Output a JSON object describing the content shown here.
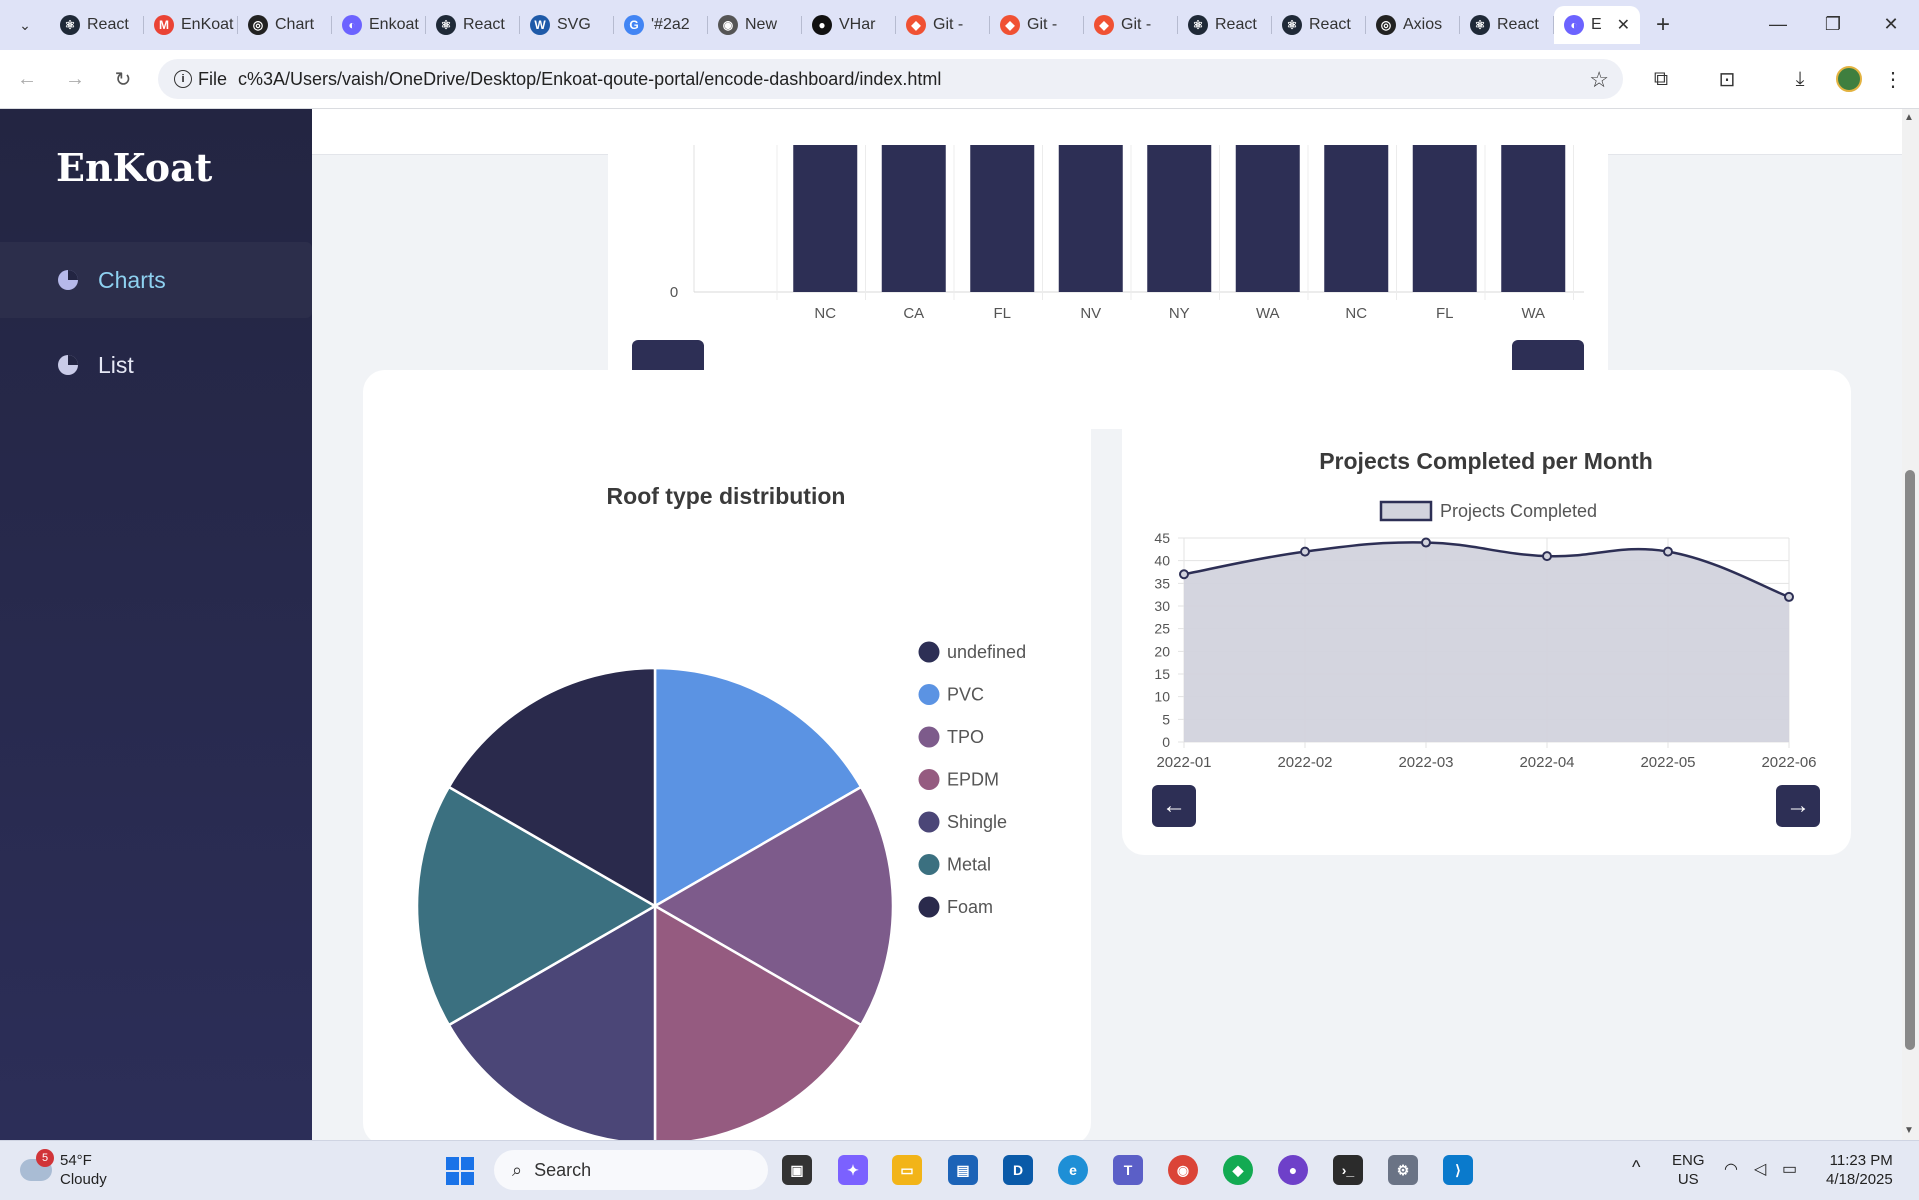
{
  "browser": {
    "tabs": [
      {
        "label": "React",
        "icon": "react-icon",
        "color": "#1f2937",
        "glyph": "⚛"
      },
      {
        "label": "EnKoat",
        "icon": "gmail-icon",
        "color": "#ea4335",
        "glyph": "M"
      },
      {
        "label": "Chart",
        "icon": "openai-icon",
        "color": "#222222",
        "glyph": "◎"
      },
      {
        "label": "Enkoat",
        "icon": "app-icon",
        "color": "#6c63ff",
        "glyph": "◐"
      },
      {
        "label": "React",
        "icon": "react-icon",
        "color": "#1f2937",
        "glyph": "⚛"
      },
      {
        "label": "SVG",
        "icon": "w3c-icon",
        "color": "#1e5aa8",
        "glyph": "W"
      },
      {
        "label": "'#2a2",
        "icon": "google-icon",
        "color": "#4285f4",
        "glyph": "G"
      },
      {
        "label": "New",
        "icon": "chrome-icon",
        "color": "#555555",
        "glyph": "◉"
      },
      {
        "label": "VHar",
        "icon": "github-icon",
        "color": "#111111",
        "glyph": "●"
      },
      {
        "label": "Git -",
        "icon": "git-icon",
        "color": "#f05133",
        "glyph": "◆"
      },
      {
        "label": "Git -",
        "icon": "git-icon",
        "color": "#f05133",
        "glyph": "◆"
      },
      {
        "label": "Git -",
        "icon": "git-icon",
        "color": "#f05133",
        "glyph": "◆"
      },
      {
        "label": "React",
        "icon": "react-icon",
        "color": "#1f2937",
        "glyph": "⚛"
      },
      {
        "label": "React",
        "icon": "react-icon",
        "color": "#1f2937",
        "glyph": "⚛"
      },
      {
        "label": "Axios",
        "icon": "openai-icon",
        "color": "#222222",
        "glyph": "◎"
      },
      {
        "label": "React",
        "icon": "react-icon",
        "color": "#1f2937",
        "glyph": "⚛"
      }
    ],
    "active_tab": {
      "label": "E",
      "icon": "app-icon",
      "color": "#6c63ff",
      "glyph": "◐",
      "close": "✕"
    },
    "file_chip": "File",
    "url": "c%3A/Users/vaish/OneDrive/Desktop/Enkoat-qoute-portal/encode-dashboard/index.html"
  },
  "sidebar": {
    "logo": "EnKoat",
    "items": [
      {
        "label": "Charts",
        "active": true
      },
      {
        "label": "List",
        "active": false
      }
    ]
  },
  "bar_card": {
    "y_tick": "0",
    "categories": [
      "NC",
      "CA",
      "FL",
      "NV",
      "NY",
      "WA",
      "NC",
      "FL",
      "WA"
    ],
    "bar_color": "#2d2f55",
    "prev": "←",
    "next": "→"
  },
  "chart_data": [
    {
      "type": "pie",
      "title": "Roof type distribution",
      "labels": [
        "undefined",
        "PVC",
        "TPO",
        "EPDM",
        "Shingle",
        "Metal",
        "Foam"
      ],
      "values": [
        0,
        1,
        1,
        1,
        1,
        1,
        1
      ],
      "colors": [
        "#2d2f55",
        "#5b93e3",
        "#7d5b8b",
        "#955b80",
        "#4b4677",
        "#3b7080",
        "#2a2a4c"
      ]
    },
    {
      "type": "area",
      "title": "Projects Completed per Month",
      "x": [
        "2022-01",
        "2022-02",
        "2022-03",
        "2022-04",
        "2022-05",
        "2022-06"
      ],
      "series": [
        {
          "name": "Projects Completed",
          "values": [
            37,
            42,
            44,
            41,
            42,
            32
          ]
        }
      ],
      "yticks": [
        "45",
        "40",
        "35",
        "30",
        "25",
        "20",
        "15",
        "10",
        "5",
        "0"
      ],
      "ylim": [
        0,
        45
      ],
      "grid": true,
      "legend": "top",
      "line_color": "#2d2f55",
      "fill_color": "#d2d3dd"
    }
  ],
  "line_card": {
    "prev": "←",
    "next": "→"
  },
  "taskbar": {
    "weather_temp": "54°F",
    "weather_desc": "Cloudy",
    "weather_badge": "5",
    "search_placeholder": "Search",
    "lang_top": "ENG",
    "lang_bottom": "US",
    "time": "11:23 PM",
    "date": "4/18/2025"
  }
}
